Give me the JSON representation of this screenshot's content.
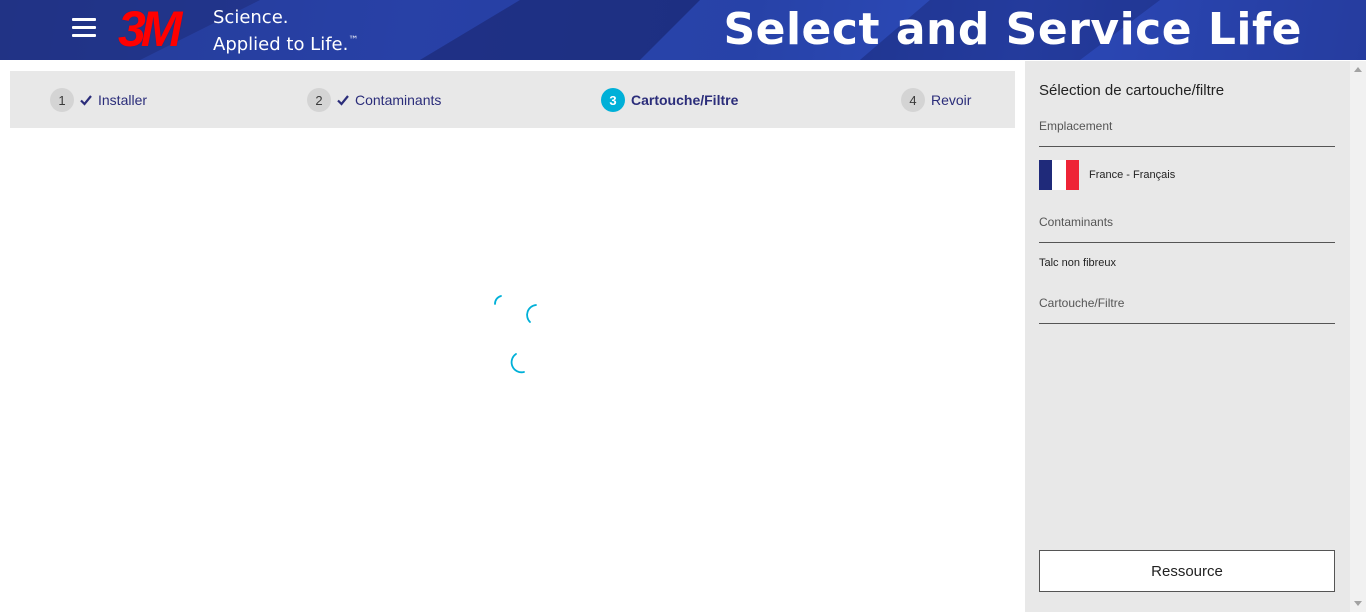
{
  "header": {
    "brand_logo": "3M",
    "tagline_line1": "Science.",
    "tagline_line2": "Applied to Life.",
    "tagline_tm": "™",
    "app_title": "Select and Service Life",
    "menu_icon": "hamburger-icon",
    "colors": {
      "header_bg": "#243a9a",
      "logo_red": "#ff0000"
    }
  },
  "stepper": {
    "steps": [
      {
        "number": "1",
        "label": "Installer",
        "completed": true,
        "active": false
      },
      {
        "number": "2",
        "label": "Contaminants",
        "completed": true,
        "active": false
      },
      {
        "number": "3",
        "label": "Cartouche/Filtre",
        "completed": false,
        "active": true
      },
      {
        "number": "4",
        "label": "Revoir",
        "completed": false,
        "active": false
      }
    ],
    "check_icon": "checkmark-icon",
    "active_color": "#00b0d8"
  },
  "main": {
    "loading_icon": "loading-spinner-icon",
    "spinner_color": "#00b0d8"
  },
  "sidebar": {
    "title": "Sélection de cartouche/filtre",
    "location": {
      "heading": "Emplacement",
      "value": "France - Français",
      "flag_icon": "france-flag-icon"
    },
    "contaminants": {
      "heading": "Contaminants",
      "value": "Talc non fibreux"
    },
    "cartridge": {
      "heading": "Cartouche/Filtre"
    },
    "resource_button": "Ressource"
  }
}
